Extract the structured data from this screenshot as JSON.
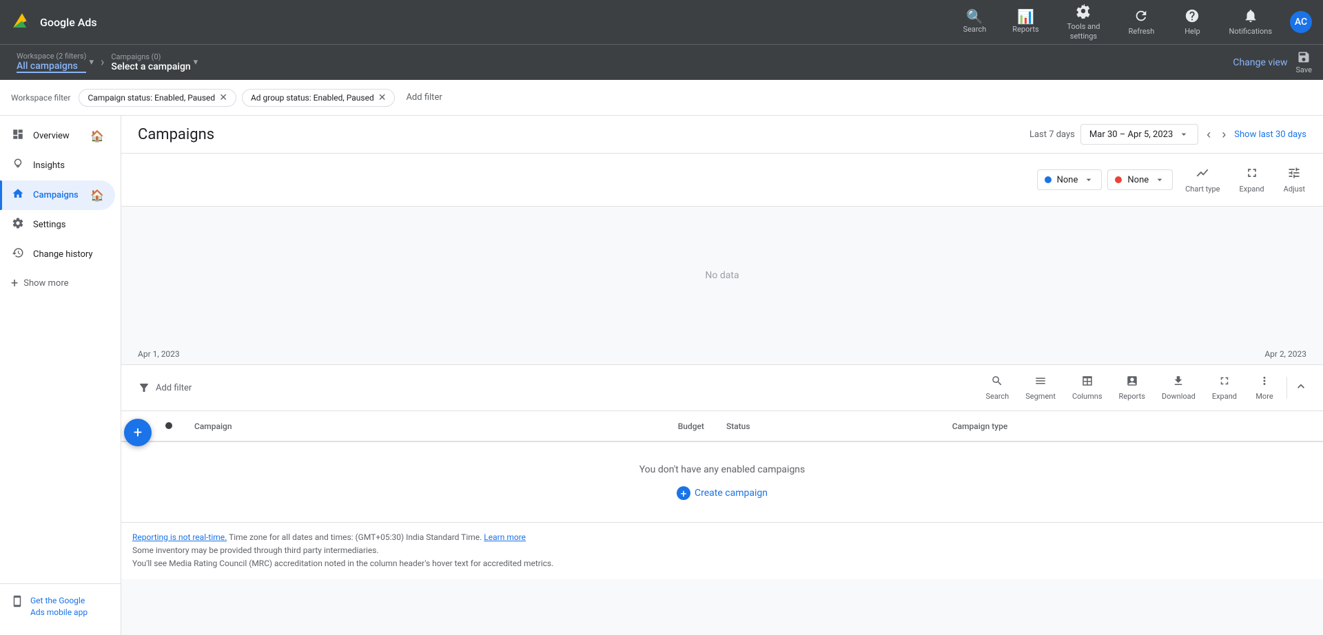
{
  "topnav": {
    "logo_text": "Google Ads",
    "actions": [
      {
        "id": "search",
        "icon": "🔍",
        "label": "Search"
      },
      {
        "id": "reports",
        "icon": "📊",
        "label": "Reports"
      },
      {
        "id": "tools",
        "icon": "🔧",
        "label": "Tools and\nsettings"
      },
      {
        "id": "refresh",
        "icon": "↻",
        "label": "Refresh"
      },
      {
        "id": "help",
        "icon": "?",
        "label": "Help"
      },
      {
        "id": "notifications",
        "icon": "🔔",
        "label": "Notifications"
      }
    ],
    "avatar": "AC"
  },
  "breadcrumb": {
    "workspace_sub": "Workspace (2 filters)",
    "workspace_main": "All campaigns",
    "campaigns_sub": "Campaigns (0)",
    "campaigns_main": "Select a campaign",
    "change_view": "Change view",
    "save": "Save"
  },
  "filters": {
    "label": "Workspace filter",
    "chips": [
      "Campaign status: Enabled, Paused",
      "Ad group status: Enabled, Paused"
    ],
    "add_filter": "Add filter"
  },
  "sidebar": {
    "items": [
      {
        "id": "overview",
        "label": "Overview",
        "icon": "⊞",
        "active": false
      },
      {
        "id": "insights",
        "label": "Insights",
        "icon": "💡",
        "active": false
      },
      {
        "id": "campaigns",
        "label": "Campaigns",
        "icon": "📋",
        "active": true
      },
      {
        "id": "settings",
        "label": "Settings",
        "icon": "⚙",
        "active": false
      },
      {
        "id": "change_history",
        "label": "Change history",
        "icon": "🕐",
        "active": false
      }
    ],
    "show_more": "Show more",
    "mobile_app_line1": "Get the Google",
    "mobile_app_line2": "Ads mobile app"
  },
  "campaigns": {
    "title": "Campaigns",
    "date_label": "Last 7 days",
    "date_range": "Mar 30 – Apr 5, 2023",
    "show_30_days": "Show last 30 days",
    "chart": {
      "no_data": "No data",
      "date_start": "Apr 1, 2023",
      "date_end": "Apr 2, 2023",
      "metric1_label": "None",
      "metric2_label": "None",
      "chart_type_label": "Chart type",
      "expand_label": "Expand",
      "adjust_label": "Adjust"
    },
    "table": {
      "add_filter": "Add filter",
      "toolbar_items": [
        {
          "id": "search",
          "icon": "🔍",
          "label": "Search"
        },
        {
          "id": "segment",
          "icon": "☰",
          "label": "Segment"
        },
        {
          "id": "columns",
          "icon": "⊞",
          "label": "Columns"
        },
        {
          "id": "reports",
          "icon": "📊",
          "label": "Reports"
        },
        {
          "id": "download",
          "icon": "⬇",
          "label": "Download"
        },
        {
          "id": "expand",
          "icon": "⤢",
          "label": "Expand"
        },
        {
          "id": "more",
          "icon": "⋮",
          "label": "More"
        }
      ],
      "columns": [
        {
          "id": "campaign",
          "label": "Campaign"
        },
        {
          "id": "budget",
          "label": "Budget"
        },
        {
          "id": "status",
          "label": "Status"
        },
        {
          "id": "campaign_type",
          "label": "Campaign type"
        }
      ],
      "empty_text": "You don't have any enabled campaigns",
      "create_campaign": "Create campaign"
    },
    "footer": {
      "realtime_text": "Reporting is not real-time.",
      "timezone_text": " Time zone for all dates and times: (GMT+05:30) India Standard Time. ",
      "learn_more": "Learn more",
      "line2": "Some inventory may be provided through third party intermediaries.",
      "line3": "You'll see Media Rating Council (MRC) accreditation noted in the column header's hover text for accredited metrics."
    }
  }
}
